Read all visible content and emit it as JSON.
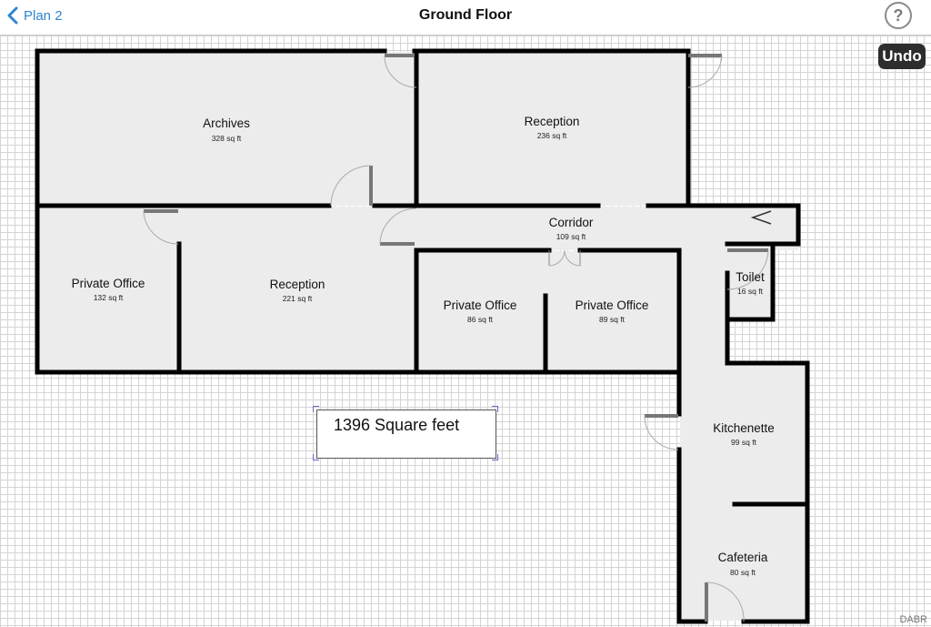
{
  "header": {
    "back_label": "Plan 2",
    "title": "Ground Floor",
    "help_label": "?"
  },
  "toolbar": {
    "undo_label": "Undo"
  },
  "rooms": [
    {
      "name": "Archives",
      "area": "328 sq ft"
    },
    {
      "name": "Reception",
      "area": "236 sq ft"
    },
    {
      "name": "Corridor",
      "area": "109 sq ft"
    },
    {
      "name": "Private Office",
      "area": "132 sq ft"
    },
    {
      "name": "Reception",
      "area": "221 sq ft"
    },
    {
      "name": "Private Office",
      "area": "86 sq ft"
    },
    {
      "name": "Private Office",
      "area": "89 sq ft"
    },
    {
      "name": "Toilet",
      "area": "16 sq ft"
    },
    {
      "name": "Kitchenette",
      "area": "99 sq ft"
    },
    {
      "name": "Cafeteria",
      "area": "80 sq ft"
    }
  ],
  "total_area_label": "1396 Square feet",
  "watermark": "DABR",
  "colors": {
    "accent": "#2f86d0",
    "room_fill": "#ececec",
    "wall": "#000000",
    "grid": "#d4d4d4",
    "undo_bg": "#2d2d2d"
  }
}
